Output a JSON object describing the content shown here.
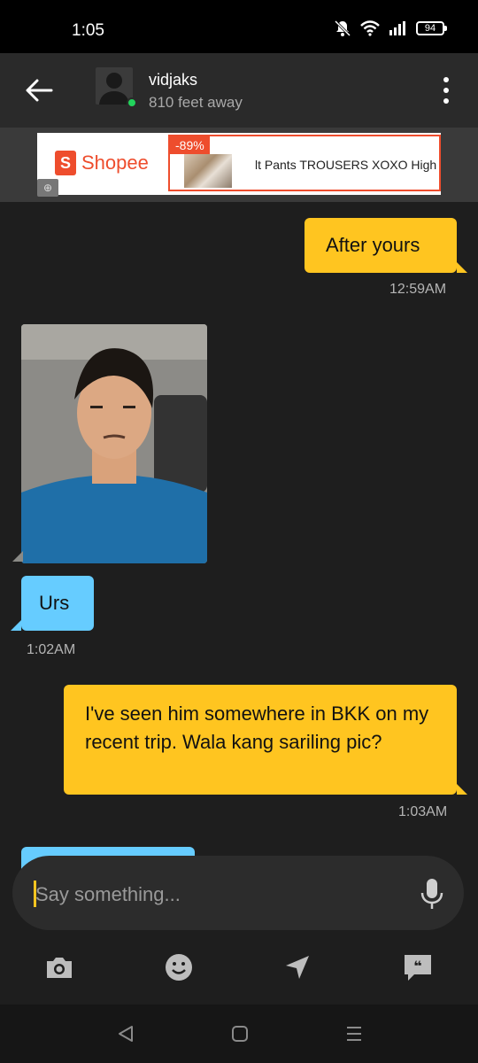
{
  "status_bar": {
    "time": "1:05",
    "battery": "94"
  },
  "header": {
    "username": "vidjaks",
    "distance": "810 feet away"
  },
  "ad": {
    "brand": "Shopee",
    "brand_letter": "S",
    "discount": "-89%",
    "products": "lt Pants    TROUSERS XOXO High"
  },
  "messages": [
    {
      "type": "sent",
      "text": "After yours",
      "time": "12:59AM"
    },
    {
      "type": "received-photo"
    },
    {
      "type": "received",
      "text": "Urs",
      "time": "1:02AM"
    },
    {
      "type": "sent",
      "text": "I've seen him somewhere in BKK on my recent trip. Wala kang sariling pic?",
      "time": "1:03AM"
    }
  ],
  "input": {
    "placeholder": "Say something..."
  },
  "colors": {
    "sent_bubble": "#ffc520",
    "received_bubble": "#66ccff",
    "online": "#22d35c",
    "background": "#1e1e1e"
  },
  "icons": [
    "back-arrow-icon",
    "more-vert-icon",
    "mic-icon",
    "camera-icon",
    "smiley-icon",
    "location-icon",
    "quick-reply-icon",
    "nav-back-icon",
    "nav-home-icon",
    "nav-menu-icon"
  ]
}
